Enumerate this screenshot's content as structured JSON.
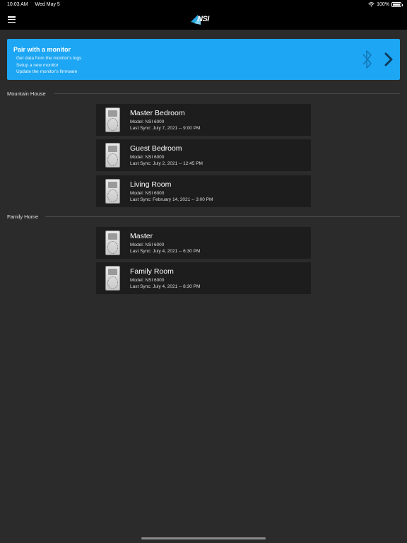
{
  "status_bar": {
    "time": "10:03 AM",
    "date": "Wed May 5",
    "battery": "100%",
    "battery_level": 1.0
  },
  "nav": {
    "logo_text": "NSI",
    "colors": {
      "logo_accent": "#29a8e0"
    }
  },
  "pair": {
    "title": "Pair with a monitor",
    "items": [
      "Get data from the monitor's logs",
      "Setup a new monitor",
      "Update the monitor's firmware"
    ],
    "color": "#1da6f3"
  },
  "groups": [
    {
      "name": "Mountain House",
      "devices": [
        {
          "name": "Master Bedroom",
          "model": "Model: NSI 6000",
          "sync": "Last Sync: July 7, 2021 -- 9:00 PM"
        },
        {
          "name": "Guest Bedroom",
          "model": "Model: NSI 6000",
          "sync": "Last Sync: July 2, 2021 -- 12:45 PM"
        },
        {
          "name": "Living Room",
          "model": "Model: NSI 6000",
          "sync": "Last Sync: February 14, 2021 -- 3:00 PM"
        }
      ]
    },
    {
      "name": "Family Home",
      "devices": [
        {
          "name": "Master",
          "model": "Model: NSI 6000",
          "sync": "Last Sync: July 4, 2021 -- 6:30 PM"
        },
        {
          "name": "Family Room",
          "model": "Model: NSI 6000",
          "sync": "Last Sync: July 4, 2021 -- 8:30 PM"
        }
      ]
    }
  ]
}
